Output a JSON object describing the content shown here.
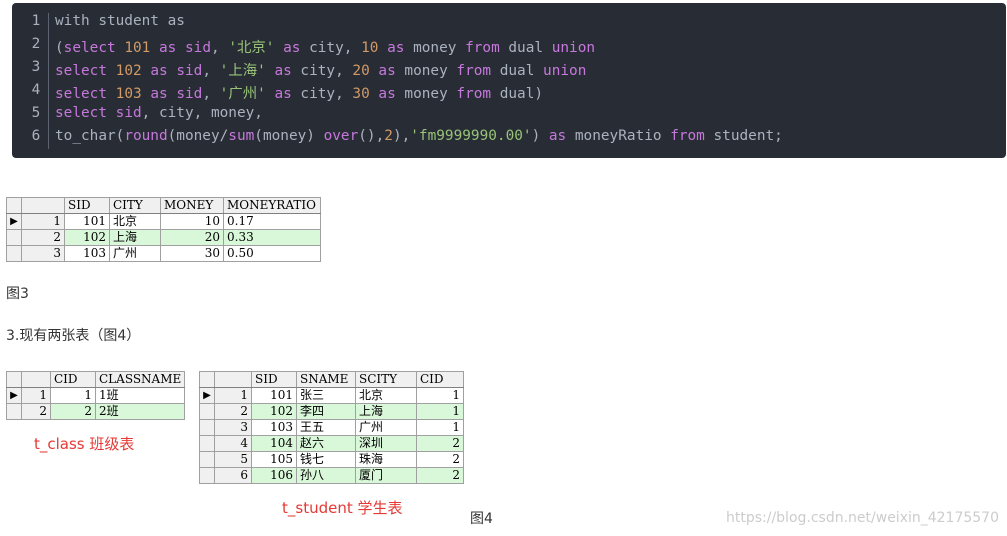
{
  "code_lines": [
    {
      "n": "1",
      "tokens": [
        [
          "p",
          "with student as"
        ]
      ]
    },
    {
      "n": "2",
      "tokens": [
        [
          "p",
          "("
        ],
        [
          "k",
          "select"
        ],
        [
          "p",
          " "
        ],
        [
          "n",
          "101"
        ],
        [
          "p",
          " "
        ],
        [
          "k",
          "as"
        ],
        [
          "p",
          " "
        ],
        [
          "k",
          "sid"
        ],
        [
          "p",
          ", "
        ],
        [
          "s",
          "'北京'"
        ],
        [
          "p",
          " "
        ],
        [
          "k",
          "as"
        ],
        [
          "p",
          " city, "
        ],
        [
          "n",
          "10"
        ],
        [
          "p",
          " "
        ],
        [
          "k",
          "as"
        ],
        [
          "p",
          " money "
        ],
        [
          "k",
          "from"
        ],
        [
          "p",
          " dual "
        ],
        [
          "k",
          "union"
        ]
      ]
    },
    {
      "n": "3",
      "tokens": [
        [
          "k",
          "select"
        ],
        [
          "p",
          " "
        ],
        [
          "n",
          "102"
        ],
        [
          "p",
          " "
        ],
        [
          "k",
          "as"
        ],
        [
          "p",
          " "
        ],
        [
          "k",
          "sid"
        ],
        [
          "p",
          ", "
        ],
        [
          "s",
          "'上海'"
        ],
        [
          "p",
          " "
        ],
        [
          "k",
          "as"
        ],
        [
          "p",
          " city, "
        ],
        [
          "n",
          "20"
        ],
        [
          "p",
          " "
        ],
        [
          "k",
          "as"
        ],
        [
          "p",
          " money "
        ],
        [
          "k",
          "from"
        ],
        [
          "p",
          " dual "
        ],
        [
          "k",
          "union"
        ]
      ]
    },
    {
      "n": "4",
      "tokens": [
        [
          "k",
          "select"
        ],
        [
          "p",
          " "
        ],
        [
          "n",
          "103"
        ],
        [
          "p",
          " "
        ],
        [
          "k",
          "as"
        ],
        [
          "p",
          " "
        ],
        [
          "k",
          "sid"
        ],
        [
          "p",
          ", "
        ],
        [
          "s",
          "'广州'"
        ],
        [
          "p",
          " "
        ],
        [
          "k",
          "as"
        ],
        [
          "p",
          " city, "
        ],
        [
          "n",
          "30"
        ],
        [
          "p",
          " "
        ],
        [
          "k",
          "as"
        ],
        [
          "p",
          " money "
        ],
        [
          "k",
          "from"
        ],
        [
          "p",
          " dual)"
        ]
      ]
    },
    {
      "n": "5",
      "tokens": [
        [
          "k",
          "select"
        ],
        [
          "p",
          " "
        ],
        [
          "k",
          "sid"
        ],
        [
          "p",
          ", city, money,"
        ]
      ]
    },
    {
      "n": "6",
      "tokens": [
        [
          "p",
          "to_char("
        ],
        [
          "f",
          "round"
        ],
        [
          "p",
          "(money/"
        ],
        [
          "f",
          "sum"
        ],
        [
          "p",
          "(money) "
        ],
        [
          "f",
          "over"
        ],
        [
          "p",
          "(),"
        ],
        [
          "n",
          "2"
        ],
        [
          "p",
          "),"
        ],
        [
          "s",
          "'fm9999990.00'"
        ],
        [
          "p",
          ") "
        ],
        [
          "k",
          "as"
        ],
        [
          "p",
          " moneyRatio "
        ],
        [
          "k",
          "from"
        ],
        [
          "p",
          " student;"
        ]
      ]
    }
  ],
  "result_grid": {
    "headers": [
      "SID",
      "CITY",
      "MONEY",
      "MONEYRATIO"
    ],
    "rows": [
      [
        "1",
        "101",
        "北京",
        "10",
        "0.17"
      ],
      [
        "2",
        "102",
        "上海",
        "20",
        "0.33"
      ],
      [
        "3",
        "103",
        "广州",
        "30",
        "0.50"
      ]
    ]
  },
  "fig3_label": "图3",
  "section_text": "3.现有两张表（图4）",
  "class_grid": {
    "headers": [
      "CID",
      "CLASSNAME"
    ],
    "rows": [
      [
        "1",
        "1",
        "1班"
      ],
      [
        "2",
        "2",
        "2班"
      ]
    ]
  },
  "student_grid": {
    "headers": [
      "SID",
      "SNAME",
      "SCITY",
      "CID"
    ],
    "rows": [
      [
        "1",
        "101",
        "张三",
        "北京",
        "1"
      ],
      [
        "2",
        "102",
        "李四",
        "上海",
        "1"
      ],
      [
        "3",
        "103",
        "王五",
        "广州",
        "1"
      ],
      [
        "4",
        "104",
        "赵六",
        "深圳",
        "2"
      ],
      [
        "5",
        "105",
        "钱七",
        "珠海",
        "2"
      ],
      [
        "6",
        "106",
        "孙八",
        "厦门",
        "2"
      ]
    ]
  },
  "t_class_label": "t_class 班级表",
  "t_student_label": "t_student 学生表",
  "fig4_label": "图4",
  "watermark": "https://blog.csdn.net/weixin_42175570",
  "row_pointer_icon": "right-triangle-icon",
  "colors": {
    "code_bg": "#282c34",
    "keyword": "#c678dd",
    "number": "#d19a66",
    "string": "#98c379",
    "alt_row": "#d9f7d9",
    "red_label": "#e53935"
  }
}
